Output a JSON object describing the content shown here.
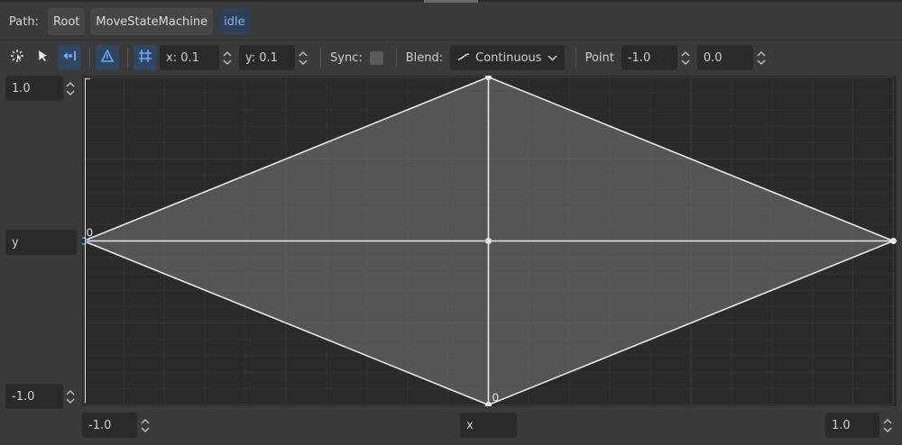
{
  "path": {
    "label": "Path:",
    "crumbs": [
      "Root",
      "MoveStateMachine",
      "idle"
    ]
  },
  "toolbar": {
    "tools": [
      "select-add-points-icon",
      "select-move-icon",
      "create-point-icon",
      "triangle-icon",
      "snap-grid-icon"
    ],
    "snap_x": "x: 0.1",
    "snap_y": "y: 0.1",
    "sync_label": "Sync:",
    "blend_label": "Blend:",
    "blend_value": "Continuous",
    "point_label": "Point",
    "point_x": "-1.0",
    "point_y": "0.0"
  },
  "axes": {
    "y_max": "1.0",
    "y_label": "y",
    "y_min": "-1.0",
    "x_min": "-1.0",
    "x_label": "x",
    "x_max": "1.0"
  },
  "blend_points": [
    {
      "x": -1.0,
      "y": 0.0,
      "label": "0"
    },
    {
      "x": 0.0,
      "y": -1.0,
      "label": "0"
    },
    {
      "x": 1.0,
      "y": 0.0,
      "label": ""
    },
    {
      "x": 0.0,
      "y": 1.0,
      "label": ""
    },
    {
      "x": 0.0,
      "y": 0.0,
      "label": ""
    }
  ],
  "colors": {
    "accent": "#4a90e2",
    "active_crumb": "#7fb3f0",
    "triangle_fill": "#8a8a8a",
    "line": "#e8e8e8"
  }
}
